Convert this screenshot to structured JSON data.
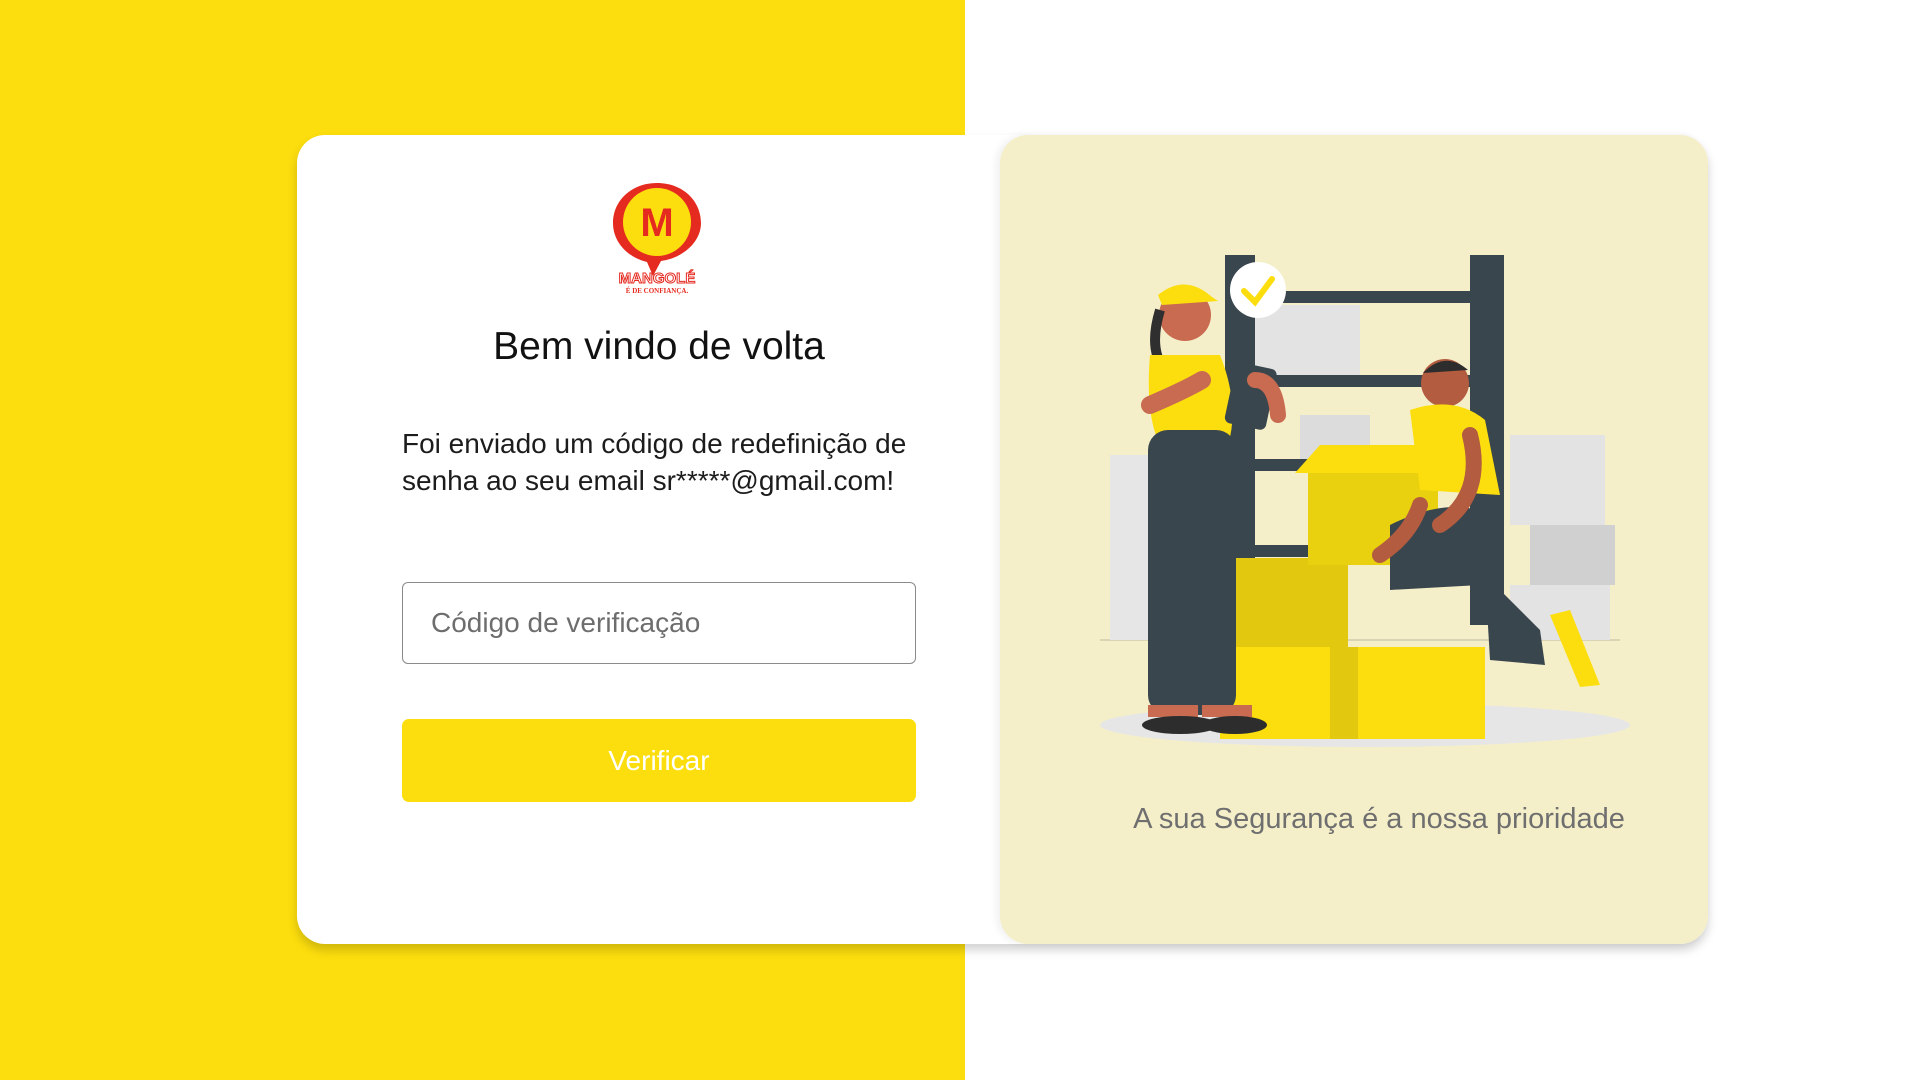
{
  "brand": {
    "logo_letter": "M",
    "logo_name": "MANGOLÉ",
    "logo_tagline": "É DE CONFIANÇA."
  },
  "login": {
    "title": "Bem vindo de volta",
    "message": "Foi enviado um código de redefinição de senha ao seu email sr*****@gmail.com!",
    "code_placeholder": "Código de verificação",
    "code_value": "",
    "verify_label": "Verificar"
  },
  "illustration_panel": {
    "tagline": "A sua Segurança é a nossa prioridade"
  },
  "colors": {
    "brand_yellow": "#fcde0e",
    "panel_cream": "#f5efc9",
    "logo_red": "#e52a1f"
  }
}
